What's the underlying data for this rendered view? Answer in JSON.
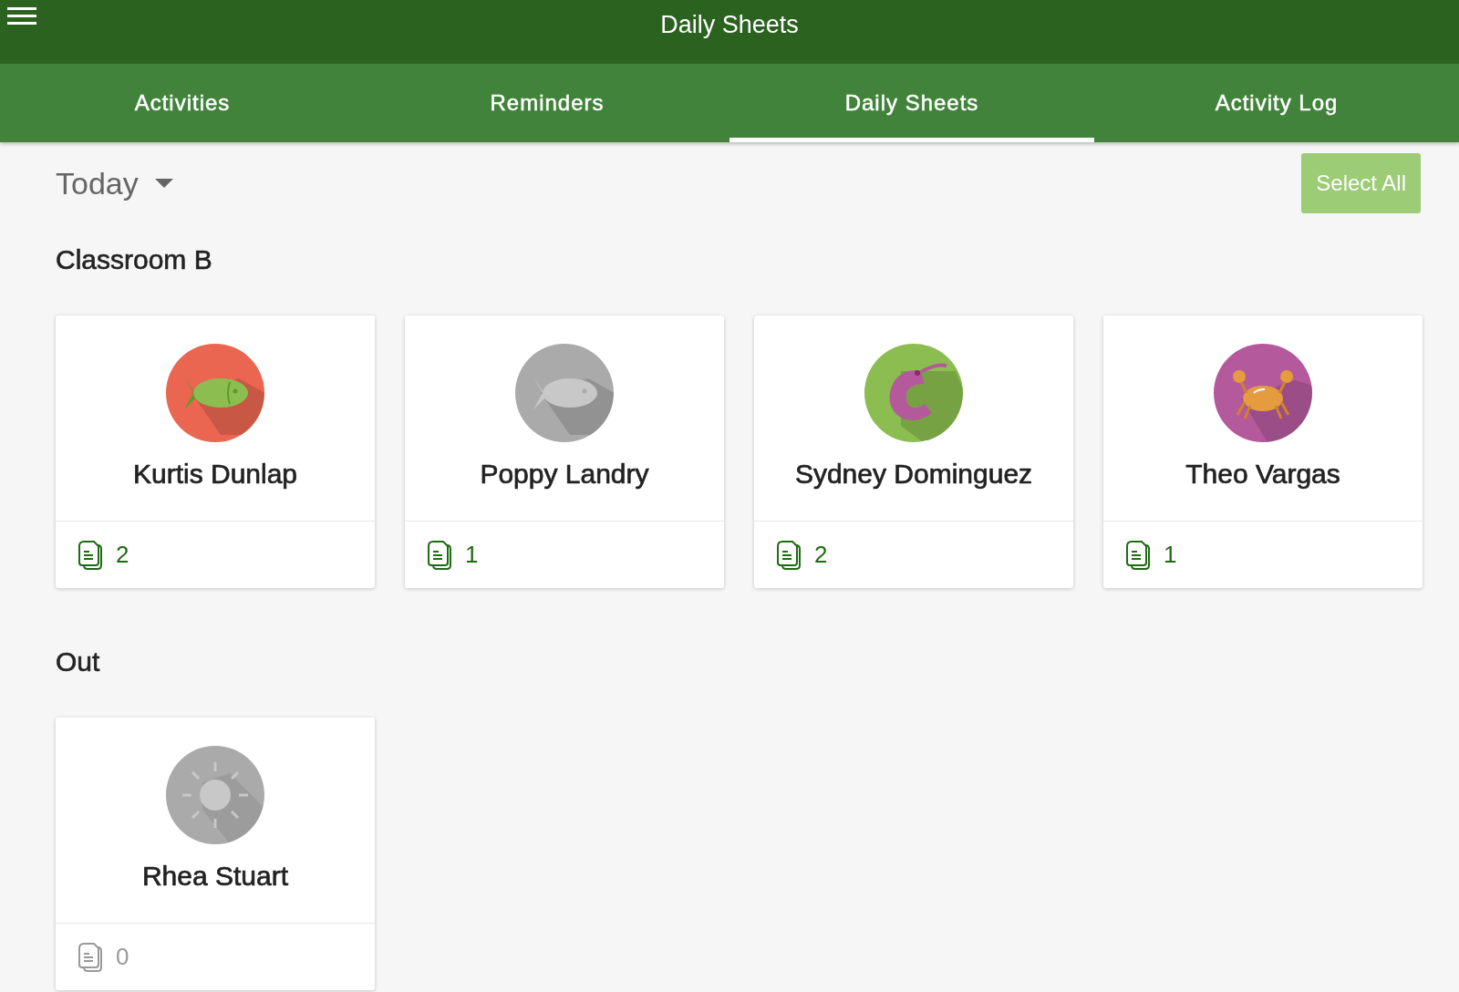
{
  "app_bar": {
    "title": "Daily Sheets"
  },
  "tabs": [
    {
      "label": "Activities",
      "selected": false
    },
    {
      "label": "Reminders",
      "selected": false
    },
    {
      "label": "Daily Sheets",
      "selected": true
    },
    {
      "label": "Activity Log",
      "selected": false
    }
  ],
  "date_filter": {
    "value": "Today"
  },
  "select_all_button": {
    "label": "Select All"
  },
  "sections": [
    {
      "title": "Classroom B",
      "students": [
        {
          "name": "Kurtis Dunlap",
          "avatar": {
            "kind": "fish",
            "color": "#eb6651",
            "dimmed": false
          },
          "sheets": "2",
          "sheets_disabled": false
        },
        {
          "name": "Poppy Landry",
          "avatar": {
            "kind": "fish",
            "color": "#aaaaaa",
            "dimmed": true
          },
          "sheets": "1",
          "sheets_disabled": false
        },
        {
          "name": "Sydney Dominguez",
          "avatar": {
            "kind": "shrimp",
            "color": "#8bbd50",
            "dimmed": false
          },
          "sheets": "2",
          "sheets_disabled": false
        },
        {
          "name": "Theo Vargas",
          "avatar": {
            "kind": "crab",
            "color": "#b45a9c",
            "dimmed": false
          },
          "sheets": "1",
          "sheets_disabled": false
        }
      ]
    },
    {
      "title": "Out",
      "students": [
        {
          "name": "Rhea Stuart",
          "avatar": {
            "kind": "sun",
            "color": "#aaaaaa",
            "dimmed": true
          },
          "sheets": "0",
          "sheets_disabled": true
        }
      ]
    }
  ]
}
